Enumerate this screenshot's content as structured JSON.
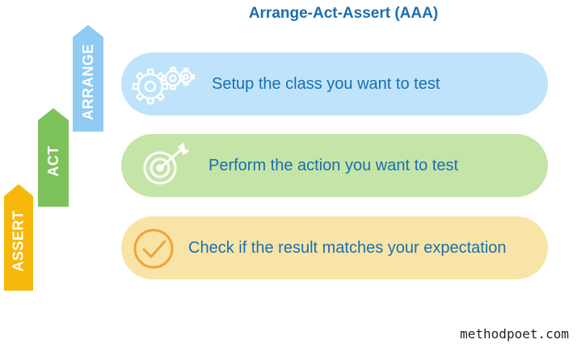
{
  "title": "Arrange-Act-Assert (AAA)",
  "steps": [
    {
      "label": "ARRANGE",
      "text": "Setup the class you want to test",
      "icon": "gears-icon",
      "arrow_color": "#8fcbf2",
      "band_color": "#bfe3fa"
    },
    {
      "label": "ACT",
      "text": "Perform the action you want to test",
      "icon": "target-icon",
      "arrow_color": "#7dc15b",
      "band_color": "#c5e4a8"
    },
    {
      "label": "ASSERT",
      "text": "Check if the result matches your expectation",
      "icon": "checkmark-icon",
      "arrow_color": "#f7b80c",
      "band_color": "#f8e4a6"
    }
  ],
  "watermark": "methodpoet.com"
}
